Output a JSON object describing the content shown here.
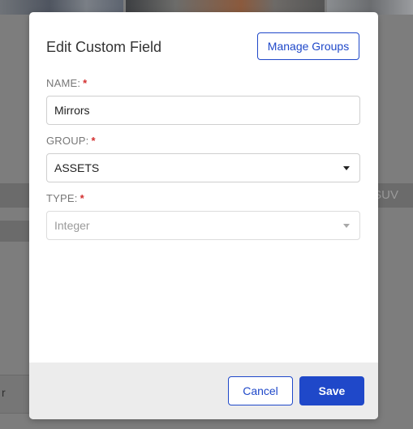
{
  "background": {
    "band_text": "SUV",
    "card_text": "r"
  },
  "modal": {
    "title": "Edit Custom Field",
    "manage_groups_label": "Manage Groups",
    "fields": {
      "name": {
        "label": "NAME:",
        "required_mark": "*",
        "value": "Mirrors"
      },
      "group": {
        "label": "GROUP:",
        "required_mark": "*",
        "value": "ASSETS"
      },
      "type": {
        "label": "TYPE:",
        "required_mark": "*",
        "value": "Integer",
        "disabled": true
      }
    },
    "footer": {
      "cancel_label": "Cancel",
      "save_label": "Save"
    }
  },
  "colors": {
    "accent": "#1f48c9",
    "required": "#d32f2f",
    "overlay": "#7d7d7d"
  },
  "icons": {
    "dropdown": "caret-down-icon"
  }
}
